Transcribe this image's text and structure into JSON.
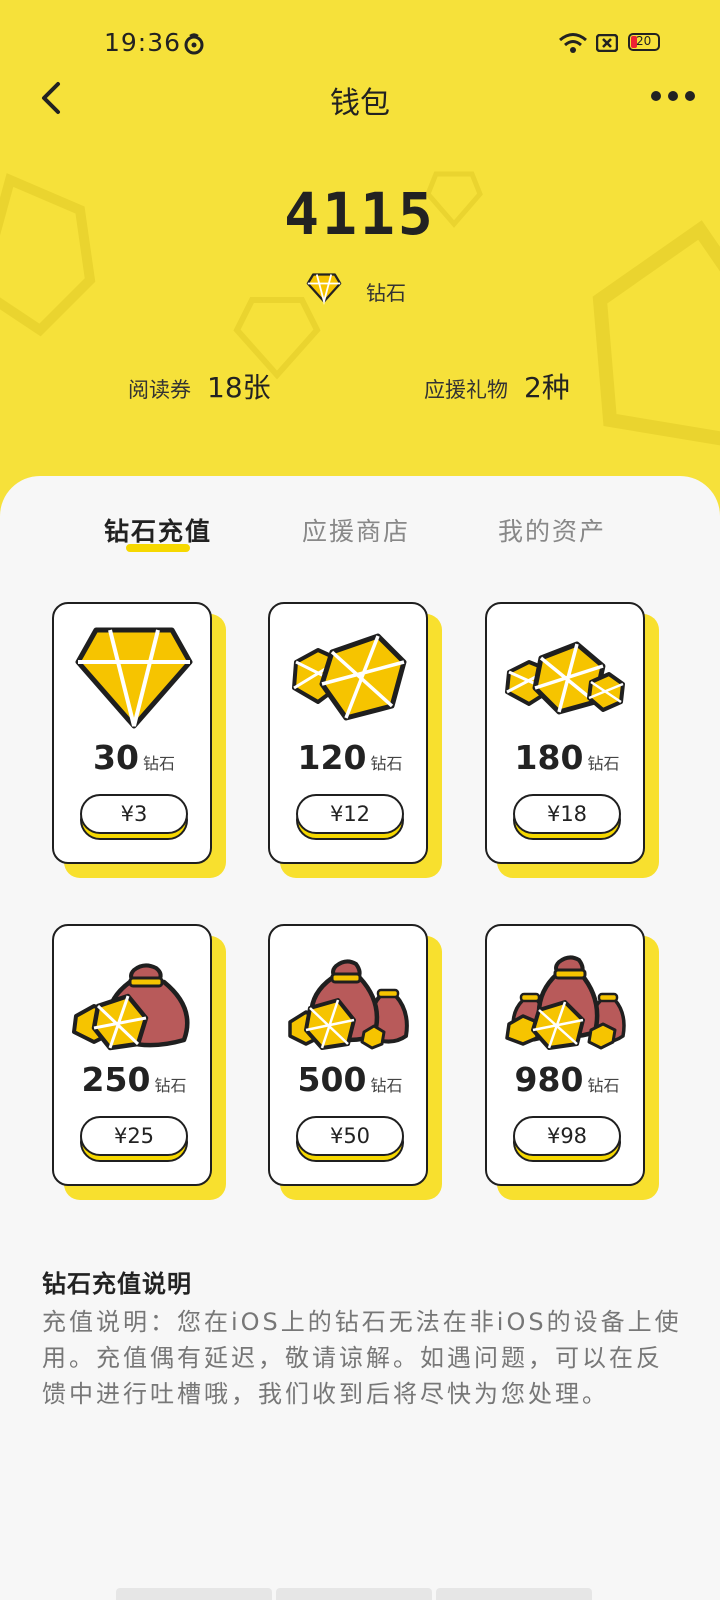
{
  "status_bar": {
    "time": "19:36",
    "battery": "20",
    "icons": [
      "netease-music-icon",
      "wifi-icon",
      "sim-icon",
      "battery-icon"
    ]
  },
  "header": {
    "title": "钱包",
    "back_icon": "back-chevron-icon",
    "more_icon": "more-dots-icon"
  },
  "wallet": {
    "balance": "4115",
    "unit_label": "钻石",
    "stats": [
      {
        "label": "阅读券",
        "value": "18张"
      },
      {
        "label": "应援礼物",
        "value": "2种"
      }
    ]
  },
  "tabs": [
    {
      "label": "钻石充值",
      "active": true
    },
    {
      "label": "应援商店",
      "active": false
    },
    {
      "label": "我的资产",
      "active": false
    }
  ],
  "packages": [
    {
      "amount": "30",
      "unit": "钻石",
      "price": "¥3",
      "icon": "single-diamond-icon"
    },
    {
      "amount": "120",
      "unit": "钻石",
      "price": "¥12",
      "icon": "two-diamonds-icon"
    },
    {
      "amount": "180",
      "unit": "钻石",
      "price": "¥18",
      "icon": "three-diamonds-icon"
    },
    {
      "amount": "250",
      "unit": "钻石",
      "price": "¥25",
      "icon": "money-bag-diamonds-icon"
    },
    {
      "amount": "500",
      "unit": "钻石",
      "price": "¥50",
      "icon": "two-money-bags-icon"
    },
    {
      "amount": "980",
      "unit": "钻石",
      "price": "¥98",
      "icon": "three-money-bags-icon"
    }
  ],
  "info": {
    "title": "钻石充值说明",
    "body": "充值说明：您在iOS上的钻石无法在非iOS的设备上使用。充值偶有延迟，敬请谅解。如遇问题，可以在反馈中进行吐槽哦，我们收到后将尽快为您处理。"
  },
  "colors": {
    "brand_yellow": "#f6e13a",
    "accent_yellow": "#f6d800",
    "bag_red": "#b85a5a",
    "outline": "#1f1f1f"
  }
}
